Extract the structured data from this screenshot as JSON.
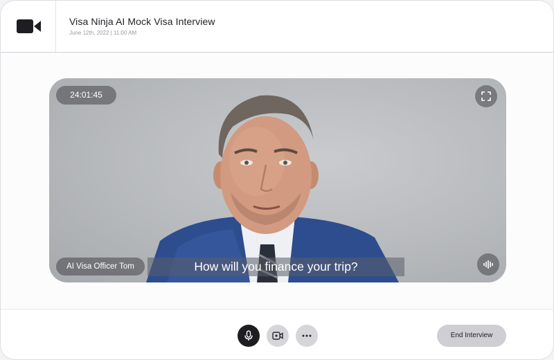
{
  "header": {
    "title": "Visa Ninja AI Mock Visa Interview",
    "subtitle": "June 12th, 2022 | 11:00 AM",
    "logo_icon": "video-camera-icon"
  },
  "video": {
    "timer": "24:01:45",
    "participant_name": "AI Visa Officer Tom",
    "caption": "How will you finance your trip?",
    "fullscreen_icon": "fullscreen-icon",
    "audio_icon": "audio-wave-icon"
  },
  "controls": {
    "mic_icon": "microphone-icon",
    "camera_icon": "camera-switch-icon",
    "more_icon": "more-dots-icon",
    "end_label": "End Interview"
  },
  "colors": {
    "primary_dark": "#1e1e22",
    "button_gray": "#d6d6da",
    "end_button": "#cfcfd3"
  }
}
